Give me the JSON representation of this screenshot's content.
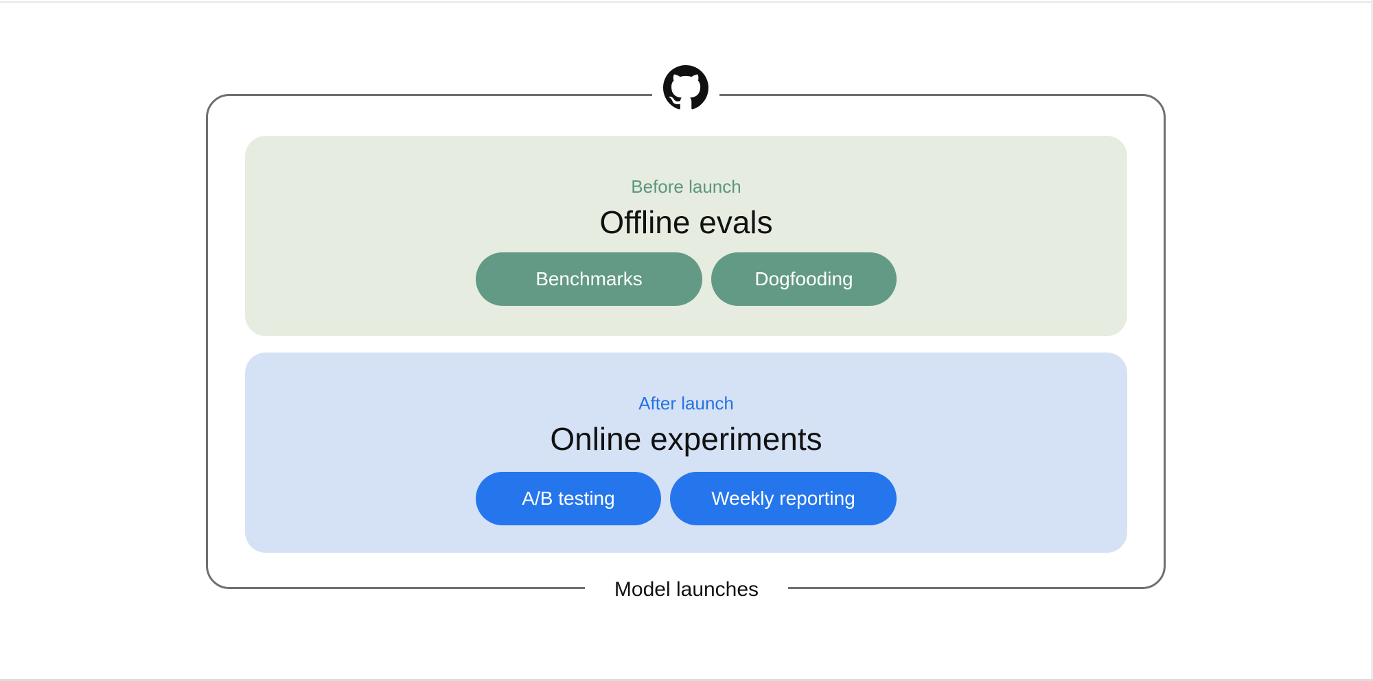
{
  "diagram": {
    "frame_label": "Model launches",
    "logo_icon": "github-icon",
    "colors": {
      "offline_panel": "#e6ecdf",
      "offline_accent": "#5c9680",
      "offline_pill": "#639a85",
      "online_panel": "#d5e2f5",
      "online_accent": "#2572e4",
      "online_pill": "#2576ec",
      "frame_border": "#6f6f6f"
    },
    "sections": [
      {
        "eyebrow": "Before launch",
        "title": "Offline evals",
        "items": [
          "Benchmarks",
          "Dogfooding"
        ]
      },
      {
        "eyebrow": "After launch",
        "title": "Online experiments",
        "items": [
          "A/B testing",
          "Weekly reporting"
        ]
      }
    ]
  }
}
